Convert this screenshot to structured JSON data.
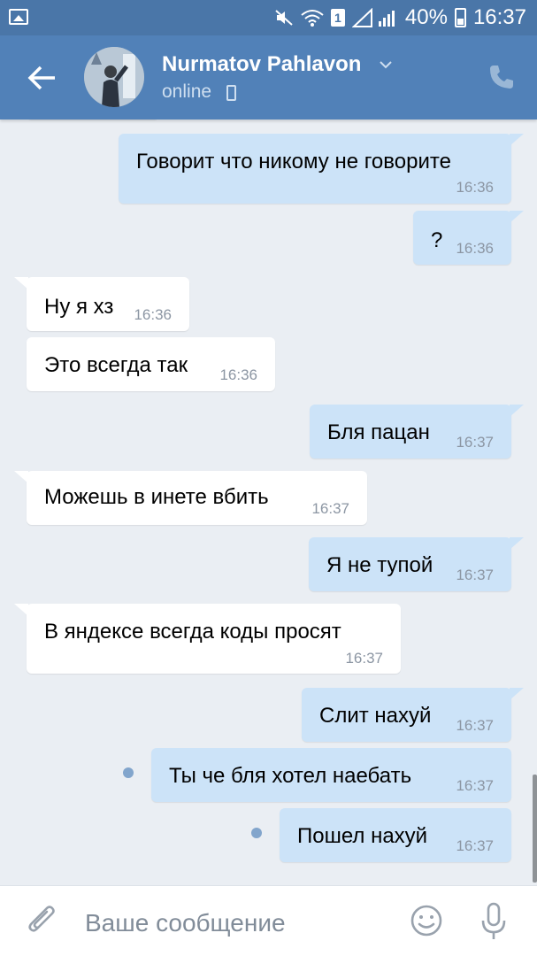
{
  "status_bar": {
    "battery_percent": "40%",
    "time": "16:37",
    "sim_slot": "1",
    "icons": [
      "gallery-icon",
      "mute-icon",
      "wifi-icon",
      "signal-icon",
      "battery-icon"
    ]
  },
  "header": {
    "contact_name": "Nurmatov Pahlavon",
    "status": "online",
    "icons": [
      "back-arrow-icon",
      "chevron-down-icon",
      "mobile-icon",
      "phone-icon"
    ]
  },
  "messages": [
    {
      "direction": "out",
      "text": "Говорит что никому не говорите",
      "time": "16:36"
    },
    {
      "direction": "out",
      "text": "?",
      "time": "16:36"
    },
    {
      "direction": "in",
      "text": "Ну я хз",
      "time": "16:36"
    },
    {
      "direction": "in",
      "text": "Это всегда так",
      "time": "16:36"
    },
    {
      "direction": "out",
      "text": "Бля пацан",
      "time": "16:37"
    },
    {
      "direction": "in",
      "text": "Можешь в инете вбить",
      "time": "16:37"
    },
    {
      "direction": "out",
      "text": "Я не тупой",
      "time": "16:37"
    },
    {
      "direction": "in",
      "text": "В яндексе всегда коды просят",
      "time": "16:37"
    },
    {
      "direction": "out",
      "text": "Слит нахуй",
      "time": "16:37"
    },
    {
      "direction": "out",
      "text": "Ты че бля хотел наебать",
      "time": "16:37",
      "unread": true
    },
    {
      "direction": "out",
      "text": "Пошел нахуй",
      "time": "16:37",
      "unread": true
    }
  ],
  "composer": {
    "placeholder": "Ваше сообщение",
    "icons": [
      "attach-icon",
      "emoji-icon",
      "microphone-icon"
    ]
  },
  "colors": {
    "header": "#5181b8",
    "status_bar": "#4a76a8",
    "background": "#eaeef3",
    "incoming_bubble": "#ffffff",
    "outgoing_bubble": "#cce3f8"
  }
}
